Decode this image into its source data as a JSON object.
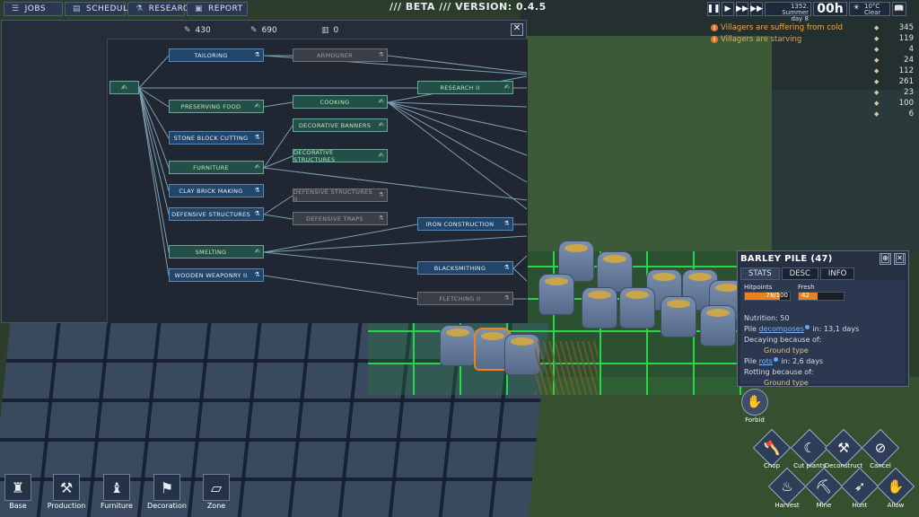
{
  "topbar": {
    "jobs": "JOBS",
    "schedule": "SCHEDULE",
    "research": "RESEARCH",
    "report": "REPORT",
    "version": "/// BETA /// VERSION: 0.4.5"
  },
  "time": {
    "date_line1": "1352. Summer",
    "date_line2": "day 8",
    "clock": "00h",
    "temp": "10°C",
    "weather": "Clear"
  },
  "alerts": [
    "Villagers are suffering from cold",
    "Villagers are starving"
  ],
  "resources": [
    {
      "icon": "villagers-icon",
      "value": "345"
    },
    {
      "icon": "wood-icon",
      "value": "119"
    },
    {
      "icon": "stone-icon",
      "value": "4"
    },
    {
      "icon": "food-icon",
      "value": "24"
    },
    {
      "icon": "grain-icon",
      "value": "112"
    },
    {
      "icon": "clay-icon",
      "value": "261"
    },
    {
      "icon": "tools-icon",
      "value": "23"
    },
    {
      "icon": "cloth-icon",
      "value": "100"
    },
    {
      "icon": "coin-icon",
      "value": "6"
    }
  ],
  "research": {
    "header_values": [
      "430",
      "690",
      "0"
    ],
    "nodes": {
      "tailoring": "TAILORING",
      "armourer": "ARMOURER",
      "research2": "RESEARCH II",
      "preserving": "PRESERVING FOOD",
      "cooking": "COOKING",
      "stone_block": "STONE BLOCK CUTTING",
      "deco_banners": "DECORATIVE BANNERS",
      "deco_structures": "DECORATIVE STRUCTURES",
      "furniture": "FURNITURE",
      "clay_brick": "CLAY BRICK MAKING",
      "def_structures2": "DEFENSIVE STRUCTURES II",
      "def_structures": "DEFENSIVE STRUCTURES",
      "def_traps": "DEFENSIVE TRAPS",
      "iron": "IRON CONSTRUCTION",
      "smelting": "SMELTING",
      "blacksmithing": "BLACKSMITHING",
      "wooden_weap": "WOODEN WEAPONRY II",
      "fletching": "FLETCHING II"
    }
  },
  "pile": {
    "title": "BARLEY PILE (47)",
    "tabs": [
      "STATS",
      "DESC",
      "INFO"
    ],
    "hp_label": "Hitpoints",
    "hp_value": "78/100",
    "hp_fraction": 0.78,
    "fresh_label": "Fresh",
    "fresh_value": "42",
    "fresh_fraction": 0.42,
    "nutrition": "Nutrition: 50",
    "decomp_prefix": "Pile ",
    "decomp_link": "decomposes",
    "decomp_suffix": " in: 13,1 days",
    "decaying": "Decaying because of:",
    "decay_reason": "Ground type",
    "rots_prefix": "Pile ",
    "rots_link": "rots",
    "rots_suffix": " in: 2,6 days",
    "rotting": "Rotting because of:",
    "rot_reason": "Ground type",
    "forbid": "Forbid"
  },
  "actions": [
    "Chop",
    "Cut plants",
    "Deconstruct",
    "Cancel",
    "Harvest",
    "Mine",
    "Hunt",
    "Allow"
  ],
  "build_menu": [
    "Base",
    "Production",
    "Furniture",
    "Decoration",
    "Zone"
  ]
}
